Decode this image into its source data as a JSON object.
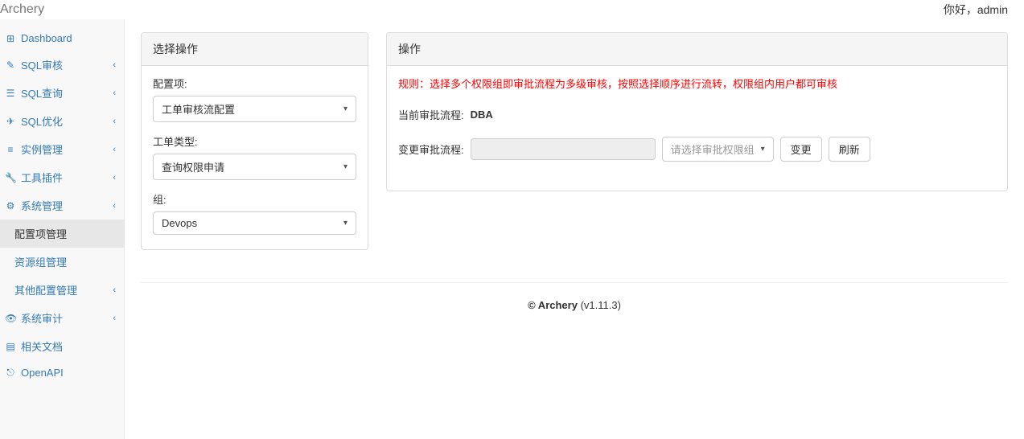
{
  "brand": "Archery",
  "greeting": "你好，admin",
  "sidebar": {
    "items": [
      {
        "icon": "dashboard",
        "label": "Dashboard",
        "hasChildren": false
      },
      {
        "icon": "pencil",
        "label": "SQL审核",
        "hasChildren": true
      },
      {
        "icon": "list",
        "label": "SQL查询",
        "hasChildren": true
      },
      {
        "icon": "rocket",
        "label": "SQL优化",
        "hasChildren": true
      },
      {
        "icon": "database",
        "label": "实例管理",
        "hasChildren": true
      },
      {
        "icon": "wrench",
        "label": "工具插件",
        "hasChildren": true
      },
      {
        "icon": "cogs",
        "label": "系统管理",
        "hasChildren": true
      },
      {
        "icon": "eye",
        "label": "系统审计",
        "hasChildren": true
      },
      {
        "icon": "book",
        "label": "相关文档",
        "hasChildren": false
      },
      {
        "icon": "api",
        "label": "OpenAPI",
        "hasChildren": false
      }
    ],
    "subitems": [
      {
        "label": "配置项管理",
        "active": true
      },
      {
        "label": "资源组管理",
        "active": false
      },
      {
        "label": "其他配置管理",
        "active": false,
        "hasChildren": true
      }
    ]
  },
  "leftPanel": {
    "heading": "选择操作",
    "fields": {
      "config_label": "配置项:",
      "config_value": "工单审核流配置",
      "type_label": "工单类型:",
      "type_value": "查询权限申请",
      "group_label": "组:",
      "group_value": "Devops"
    }
  },
  "rightPanel": {
    "heading": "操作",
    "rule": "规则：选择多个权限组即审批流程为多级审核，按照选择顺序进行流转，权限组内用户都可审核",
    "current_flow_label": "当前审批流程:",
    "current_flow_value": "DBA",
    "change_flow_label": "变更审批流程:",
    "select_placeholder": "请选择审批权限组",
    "change_button": "变更",
    "refresh_button": "刷新"
  },
  "footer": {
    "copyright_name": "© Archery",
    "version": " (v1.11.3)"
  },
  "icons": {
    "dashboard": "⊞",
    "pencil": "✎",
    "list": "☰",
    "rocket": "✈",
    "database": "≡",
    "wrench": "🔧",
    "cogs": "⚙",
    "eye": "👁",
    "book": "▤",
    "api": "⎋"
  }
}
